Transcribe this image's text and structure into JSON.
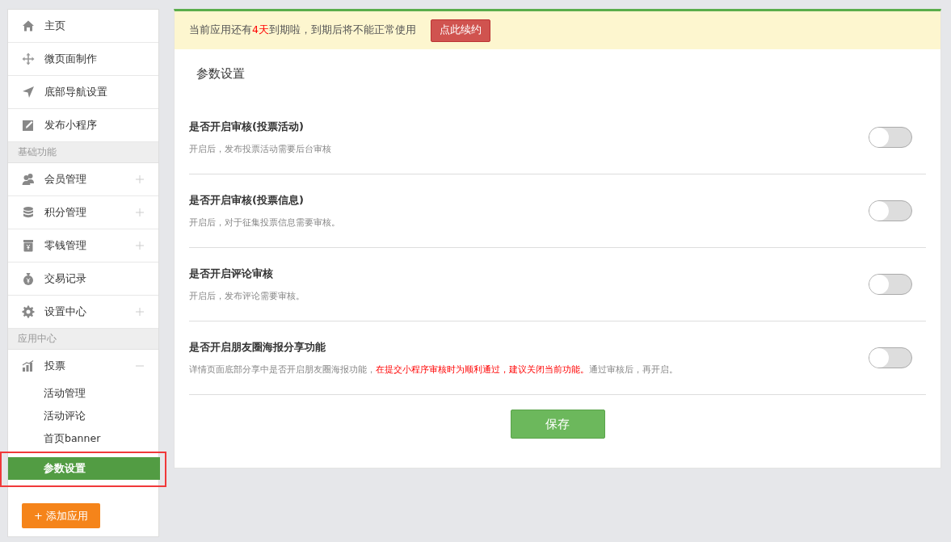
{
  "sidebar": {
    "items": [
      {
        "kind": "link",
        "label": "主页"
      },
      {
        "kind": "link",
        "label": "微页面制作"
      },
      {
        "kind": "link",
        "label": "底部导航设置"
      },
      {
        "kind": "link",
        "label": "发布小程序"
      },
      {
        "kind": "section",
        "label": "基础功能"
      },
      {
        "kind": "group",
        "label": "会员管理",
        "expanded": false
      },
      {
        "kind": "group",
        "label": "积分管理",
        "expanded": false
      },
      {
        "kind": "group",
        "label": "零钱管理",
        "expanded": false
      },
      {
        "kind": "link",
        "label": "交易记录"
      },
      {
        "kind": "group",
        "label": "设置中心",
        "expanded": false
      },
      {
        "kind": "section",
        "label": "应用中心"
      },
      {
        "kind": "group",
        "label": "投票",
        "expanded": true,
        "children": [
          {
            "label": "活动管理",
            "selected": false
          },
          {
            "label": "活动评论",
            "selected": false
          },
          {
            "label": "首页banner",
            "selected": false
          },
          {
            "label": "参数设置",
            "selected": true
          }
        ]
      }
    ],
    "add_button": "+ 添加应用"
  },
  "notice": {
    "before": "当前应用还有",
    "highlight": "4天",
    "after": "到期啦，到期后将不能正常使用",
    "button": "点此续约"
  },
  "page_title": "参数设置",
  "settings": [
    {
      "title": "是否开启审核(投票活动)",
      "description": [
        {
          "kind": "normal",
          "text": "开启后，发布投票活动需要后台审核"
        }
      ],
      "on": false
    },
    {
      "title": "是否开启审核(投票信息)",
      "description": [
        {
          "kind": "normal",
          "text": "开启后，对于征集投票信息需要审核。"
        }
      ],
      "on": false
    },
    {
      "title": "是否开启评论审核",
      "description": [
        {
          "kind": "normal",
          "text": "开启后，发布评论需要审核。"
        }
      ],
      "on": false
    },
    {
      "title": "是否开启朋友圈海报分享功能",
      "description": [
        {
          "kind": "normal",
          "text": "详情页面底部分享中是否开启朋友圈海报功能，"
        },
        {
          "kind": "warning",
          "text": "在提交小程序审核时为顺利通过，建议关闭当前功能。"
        },
        {
          "kind": "normal",
          "text": "通过审核后，再开启。"
        }
      ],
      "on": false
    }
  ],
  "save_button": "保存"
}
